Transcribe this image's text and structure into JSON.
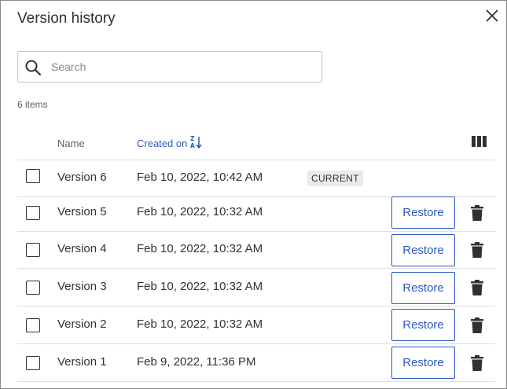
{
  "dialog": {
    "title": "Version history",
    "close_icon": "close-icon"
  },
  "search": {
    "placeholder": "Search",
    "value": "",
    "icon": "search-icon"
  },
  "list": {
    "item_count": "6 items",
    "columns": {
      "name": "Name",
      "created_on": "Created on",
      "sort_icon": "sort-descending-icon",
      "column_options_icon": "columns-icon"
    },
    "rows": [
      {
        "name": "Version 6",
        "created": "Feb 10, 2022, 10:42 AM",
        "badge": "CURRENT",
        "restore_label": "",
        "checked": false
      },
      {
        "name": "Version 5",
        "created": "Feb 10, 2022, 10:32 AM",
        "badge": "",
        "restore_label": "Restore",
        "checked": false
      },
      {
        "name": "Version 4",
        "created": "Feb 10, 2022, 10:32 AM",
        "badge": "",
        "restore_label": "Restore",
        "checked": false
      },
      {
        "name": "Version 3",
        "created": "Feb 10, 2022, 10:32 AM",
        "badge": "",
        "restore_label": "Restore",
        "checked": false
      },
      {
        "name": "Version 2",
        "created": "Feb 10, 2022, 10:32 AM",
        "badge": "",
        "restore_label": "Restore",
        "checked": false
      },
      {
        "name": "Version 1",
        "created": "Feb 9, 2022, 11:36 PM",
        "badge": "",
        "restore_label": "Restore",
        "checked": false
      }
    ]
  },
  "colors": {
    "accent": "#2b59c3",
    "text": "#323130",
    "muted": "#605e5c",
    "divider": "#e1dfdd",
    "badge_bg": "#edebe9"
  }
}
